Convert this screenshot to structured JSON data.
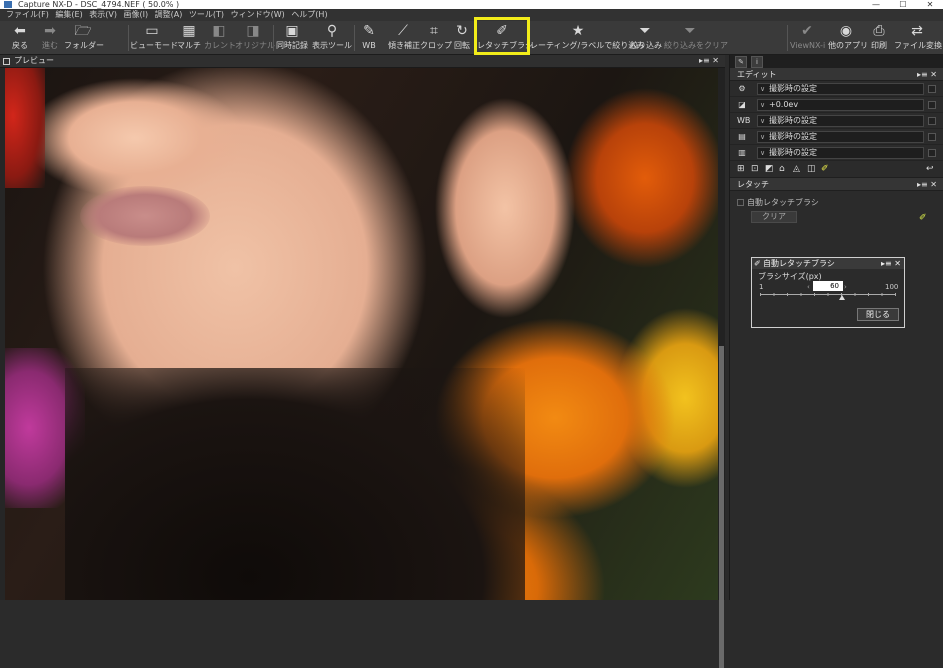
{
  "window": {
    "title": "Capture NX-D - DSC_4794.NEF ( 50.0% )",
    "min": "—",
    "max": "☐",
    "close": "✕"
  },
  "menu": [
    "ファイル(F)",
    "編集(E)",
    "表示(V)",
    "画像(I)",
    "調整(A)",
    "ツール(T)",
    "ウィンドウ(W)",
    "ヘルプ(H)"
  ],
  "toolbar": {
    "back": {
      "icon": "⬅",
      "label": "戻る"
    },
    "forward": {
      "icon": "➡",
      "label": "進む"
    },
    "folder": {
      "icon": "🗁",
      "label": "フォルダー"
    },
    "viewmode": {
      "icon": "▭",
      "label": "ビューモード"
    },
    "multi": {
      "icon": "▦",
      "label": "マルチ"
    },
    "current": {
      "icon": "◧",
      "label": "カレント"
    },
    "original": {
      "icon": "◨",
      "label": "オリジナル"
    },
    "simul": {
      "icon": "▣",
      "label": "同時記録"
    },
    "displaytool": {
      "icon": "⚲",
      "label": "表示ツール"
    },
    "wb": {
      "icon": "✎",
      "label": "WB"
    },
    "tilt": {
      "icon": "⟋",
      "label": "傾き補正"
    },
    "crop": {
      "icon": "⌗",
      "label": "クロップ"
    },
    "rotate": {
      "icon": "↻",
      "label": "回転"
    },
    "retouch": {
      "icon": "✐",
      "label": "レタッチブラシ"
    },
    "rating": {
      "icon": "★",
      "label": "レーティング/ラベルで絞り込み"
    },
    "filter": {
      "icon": "⏷",
      "label": "絞り込み"
    },
    "filterclear": {
      "icon": "⏷",
      "label": "絞り込みをクリア"
    },
    "viewnx": {
      "icon": "✔",
      "label": "ViewNX-i"
    },
    "otherapps": {
      "icon": "◉",
      "label": "他のアプリ"
    },
    "print": {
      "icon": "⎙",
      "label": "印刷"
    },
    "convert": {
      "icon": "⇄",
      "label": "ファイル変換"
    }
  },
  "preview": {
    "title": "プレビュー",
    "controls": "▸≡ ✕"
  },
  "edit_panel": {
    "title": "エディット",
    "controls": "▸≡ ✕",
    "rows": [
      {
        "icon": "⚙",
        "value": "撮影時の設定"
      },
      {
        "icon": "◪",
        "value": "+0.0ev"
      },
      {
        "icon": "WB",
        "value": "撮影時の設定"
      },
      {
        "icon": "▤",
        "value": "撮影時の設定"
      },
      {
        "icon": "▥",
        "value": "撮影時の設定"
      }
    ],
    "tools": [
      "⊞",
      "⊡",
      "◩",
      "⌂",
      "◬",
      "◫",
      "✐"
    ],
    "undo": "↩"
  },
  "retouch_panel": {
    "title": "レタッチ",
    "controls": "▸≡ ✕",
    "auto_checkbox": "自動レタッチブラシ",
    "clear_button": "クリア",
    "brush_icon": "✐",
    "dialog": {
      "title": "自動レタッチブラシ",
      "controls": "▸≡ ✕",
      "size_label": "ブラシサイズ(px)",
      "min": "1",
      "max": "100",
      "value": "60",
      "close_button": "閉じる"
    }
  }
}
